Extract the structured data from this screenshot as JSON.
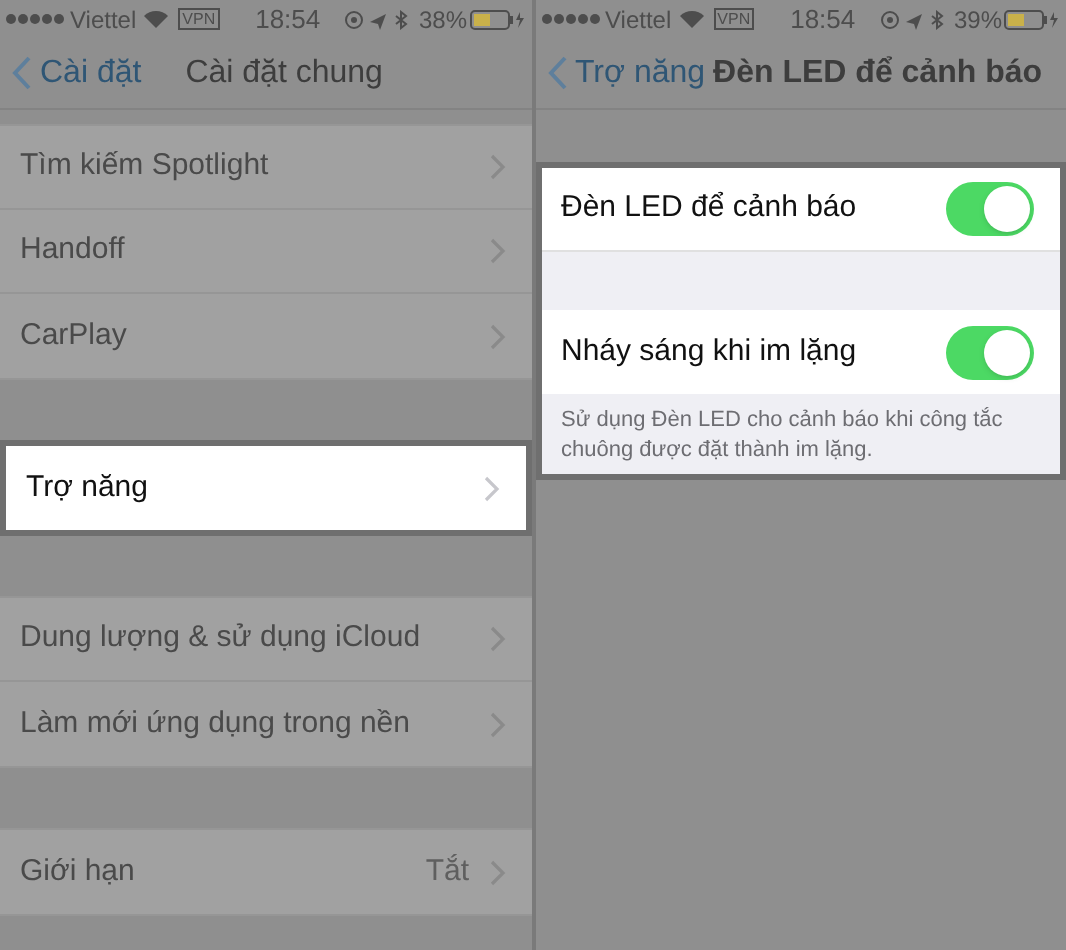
{
  "screens": [
    {
      "status_bar": {
        "carrier": "Viettel",
        "vpn": "VPN",
        "time": "18:54",
        "battery": "38%"
      },
      "nav": {
        "back": "Cài đặt",
        "title": "Cài đặt chung"
      },
      "groups": [
        {
          "highlighted": false,
          "rows": [
            {
              "kind": "link",
              "label": "Tìm kiếm Spotlight"
            },
            {
              "kind": "link",
              "label": "Handoff"
            },
            {
              "kind": "link",
              "label": "CarPlay"
            }
          ]
        },
        {
          "highlighted": true,
          "rows": [
            {
              "kind": "link",
              "label": "Trợ năng"
            }
          ]
        },
        {
          "highlighted": false,
          "rows": [
            {
              "kind": "link",
              "label": "Dung lượng & sử dụng iCloud"
            },
            {
              "kind": "link",
              "label": "Làm mới ứng dụng trong nền"
            }
          ]
        },
        {
          "highlighted": false,
          "rows": [
            {
              "kind": "link",
              "label": "Giới hạn",
              "value": "Tắt"
            }
          ]
        }
      ]
    },
    {
      "status_bar": {
        "carrier": "Viettel",
        "vpn": "VPN",
        "time": "18:54",
        "battery": "39%"
      },
      "nav": {
        "back": "Trợ năng",
        "title": "Đèn LED để cảnh báo"
      },
      "groups": [
        {
          "highlighted": true,
          "rows": [
            {
              "kind": "toggle",
              "label": "Đèn LED để cảnh báo",
              "on": true
            },
            {
              "kind": "spacer"
            },
            {
              "kind": "toggle",
              "label": "Nháy sáng khi im lặng",
              "on": true
            }
          ],
          "footer": "Sử dụng Đèn LED cho cảnh báo khi công tắc chuông được đặt thành im lặng."
        }
      ]
    }
  ]
}
